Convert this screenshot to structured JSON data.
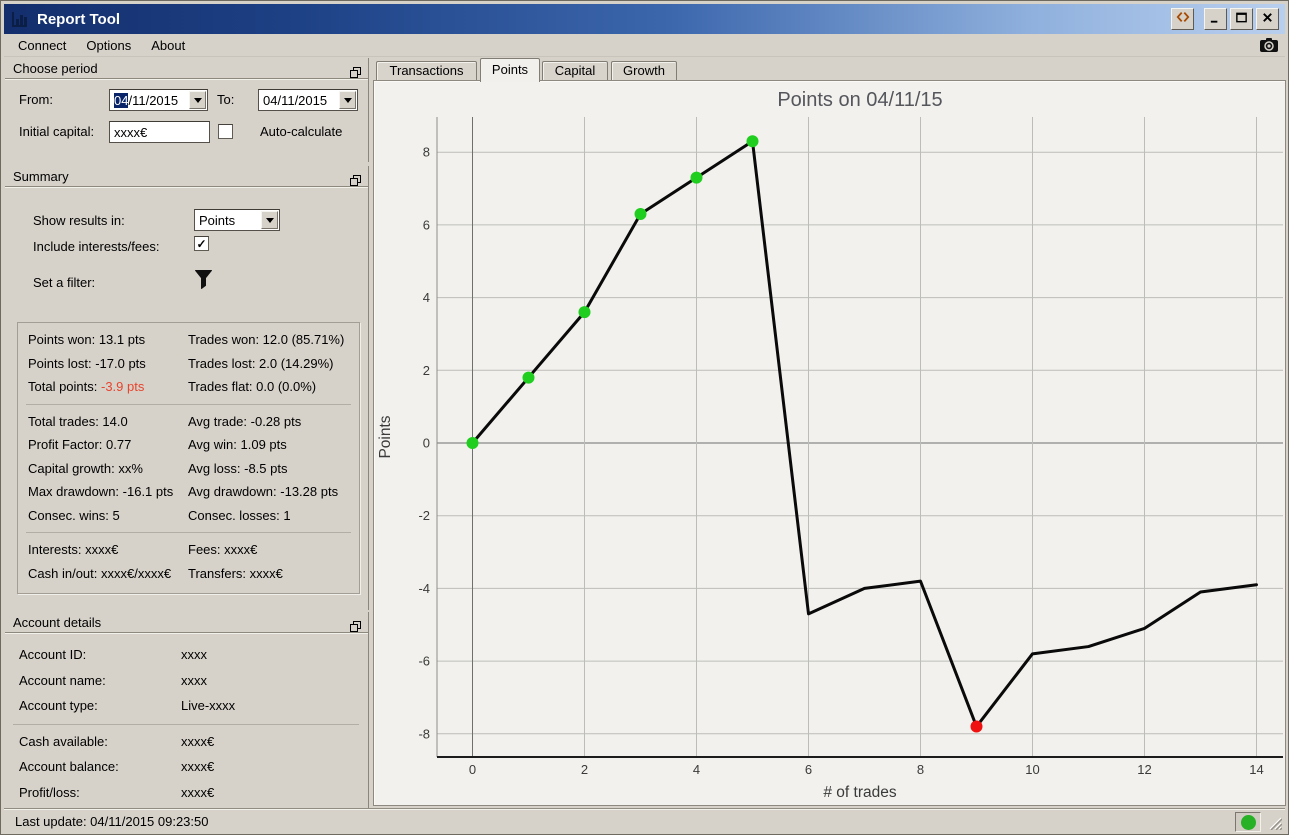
{
  "titlebar": {
    "title": "Report Tool"
  },
  "menubar": {
    "items": [
      "Connect",
      "Options",
      "About"
    ]
  },
  "icons": {
    "app": "bar-chart-icon",
    "titlebar_buttons": [
      "detach-arrows-icon",
      "minimize-icon",
      "maximize-icon",
      "close-icon"
    ],
    "menubar_right": "camera-icon",
    "section_corner": "float-window-icon",
    "filter": "funnel-icon"
  },
  "colors": {
    "selection": "#0a246a",
    "negative_text": "#e8442e",
    "connection_led": "#27b127"
  },
  "left_panel": {
    "choose_period": {
      "title": "Choose period",
      "from_label": "From:",
      "from_value_sel": "04",
      "from_value_rest": "/11/2015",
      "to_label": "To:",
      "to_value": "04/11/2015",
      "initial_capital_label": "Initial capital:",
      "initial_capital_value": "xxxx€",
      "auto_calculate_checked": false,
      "auto_calculate_label": "Auto-calculate"
    },
    "summary": {
      "title": "Summary",
      "show_results_label": "Show results in:",
      "show_results_value": "Points",
      "include_label": "Include interests/fees:",
      "include_checked": true,
      "filter_label": "Set a filter:",
      "stats_groups": [
        [
          {
            "left": "Points won: 13.1 pts",
            "right": "Trades won: 12.0 (85.71%)"
          },
          {
            "left": "Points lost: -17.0 pts",
            "right": "Trades lost: 2.0 (14.29%)"
          },
          {
            "left": "Total points: ",
            "left_red": "-3.9 pts",
            "right": "Trades flat: 0.0 (0.0%)"
          }
        ],
        [
          {
            "left": "Total trades: 14.0",
            "right": "Avg trade: -0.28 pts"
          },
          {
            "left": "Profit Factor: 0.77",
            "right": "Avg win: 1.09 pts"
          },
          {
            "left": "Capital growth: xx%",
            "right": "Avg loss: -8.5 pts"
          },
          {
            "left": "Max drawdown: -16.1 pts",
            "right": "Avg drawdown: -13.28 pts"
          },
          {
            "left": "Consec. wins: 5",
            "right": "Consec. losses: 1"
          }
        ],
        [
          {
            "left": "Interests: xxxx€",
            "right": "Fees: xxxx€"
          },
          {
            "left": "Cash in/out: xxxx€/xxxx€",
            "right": "Transfers: xxxx€"
          }
        ]
      ]
    },
    "account_details": {
      "title": "Account details",
      "groups": [
        [
          {
            "label": "Account ID:",
            "value": "xxxx"
          },
          {
            "label": "Account name:",
            "value": "xxxx"
          },
          {
            "label": "Account type:",
            "value": "Live-xxxx"
          }
        ],
        [
          {
            "label": "Cash available:",
            "value": "xxxx€"
          },
          {
            "label": "Account balance:",
            "value": "xxxx€"
          },
          {
            "label": "Profit/loss:",
            "value": "xxxx€"
          }
        ]
      ]
    }
  },
  "statusbar": {
    "last_update": "Last update: 04/11/2015 09:23:50"
  },
  "tabs": [
    {
      "label": "Transactions",
      "active": false
    },
    {
      "label": "Points",
      "active": true
    },
    {
      "label": "Capital",
      "active": false
    },
    {
      "label": "Growth",
      "active": false
    }
  ],
  "chart_data": {
    "type": "line",
    "title": "Points on 04/11/15",
    "xlabel": "# of trades",
    "ylabel": "Points",
    "x": [
      0,
      1,
      2,
      3,
      4,
      5,
      6,
      7,
      8,
      9,
      10,
      11,
      12,
      13,
      14
    ],
    "y": [
      0,
      1.8,
      3.6,
      6.3,
      7.3,
      8.3,
      -4.7,
      -4.0,
      -3.8,
      -7.8,
      -5.8,
      -5.6,
      -5.1,
      -4.1,
      -3.9
    ],
    "markers": {
      "green_indices": [
        0,
        1,
        2,
        3,
        4,
        5
      ],
      "red_indices": [
        9
      ]
    },
    "xticks": [
      0,
      2,
      4,
      6,
      8,
      10,
      12,
      14
    ],
    "yticks": [
      -8,
      -6,
      -4,
      -2,
      0,
      2,
      4,
      6,
      8
    ],
    "xlim": [
      -0.63,
      14.5
    ],
    "ylim": [
      -8.65,
      9.0
    ],
    "grid": true,
    "legend": null,
    "line_color": "#0a0a0a",
    "grid_color": "#bcbcba",
    "zero_line_color": "#6f6f6f",
    "axis_color": "#1c1c1c",
    "marker_green": "#1fce1f",
    "marker_red": "#ef1010",
    "title_color": "#54565c",
    "tick_color": "#3a3a3a",
    "background": "#f2f1ed"
  }
}
